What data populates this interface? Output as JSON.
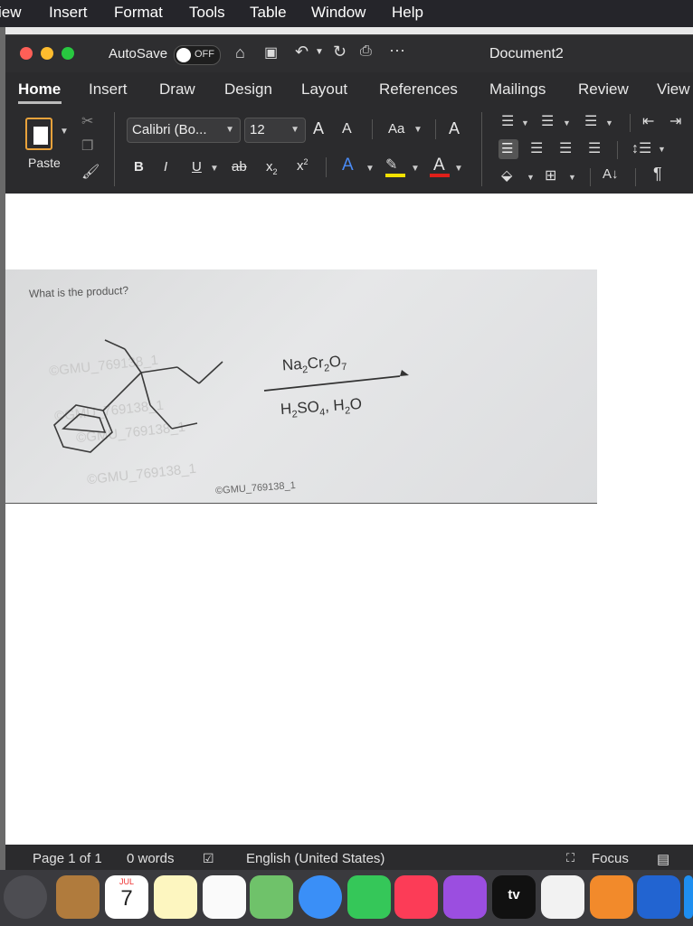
{
  "menubar": {
    "items": [
      "iew",
      "Insert",
      "Format",
      "Tools",
      "Table",
      "Window",
      "Help"
    ]
  },
  "titlebar": {
    "autosave_label": "AutoSave",
    "autosave_state": "OFF",
    "doc_title": "Document2"
  },
  "tabs": [
    "Home",
    "Insert",
    "Draw",
    "Design",
    "Layout",
    "References",
    "Mailings",
    "Review",
    "View"
  ],
  "ribbon": {
    "paste_label": "Paste",
    "font_name": "Calibri (Bo...",
    "font_size": "12",
    "bold": "B",
    "italic": "I",
    "underline": "U",
    "strike": "ab",
    "subscript": "x",
    "superscript": "x",
    "change_case": "Aa",
    "grow": "A",
    "shrink": "A",
    "text_effect": "A",
    "font_color": "A",
    "pilcrow": "¶"
  },
  "document": {
    "question": "What is the product?",
    "reagent_top": "Na2Cr2O7",
    "reagent_bottom": "H2SO4, H2O",
    "watermarks": [
      "©GMU_769138_1",
      "©GMU_769138_1",
      "©GMU_769138_1",
      "©GMU_769138_1",
      "©GMU_769138_1"
    ]
  },
  "statusbar": {
    "page": "Page 1 of 1",
    "words": "0 words",
    "language": "English (United States)",
    "focus": "Focus"
  },
  "dock": {
    "calendar_month": "JUL",
    "calendar_day": "7",
    "tv_label": "tv"
  },
  "colors": {
    "highlight": "#f4e200",
    "font_color": "#e0201a",
    "accent": "#3478f6"
  }
}
